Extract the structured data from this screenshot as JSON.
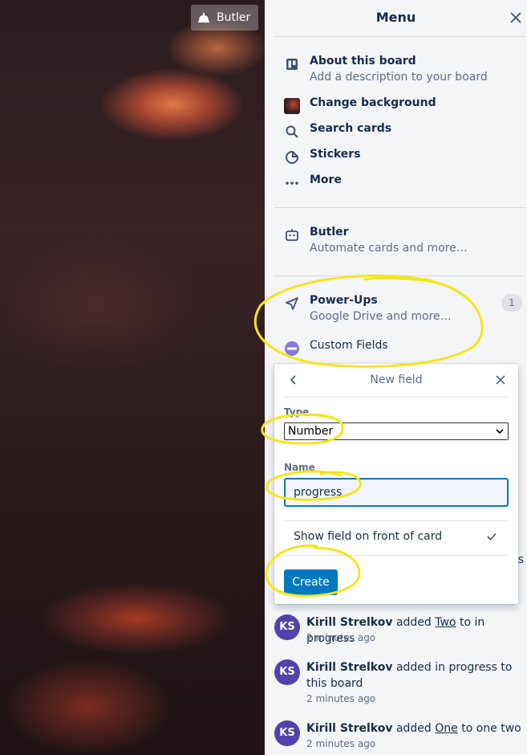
{
  "board": {
    "butler_button_label": "Butler"
  },
  "menu": {
    "title": "Menu",
    "items": [
      {
        "label": "About this board",
        "sub": "Add a description to your board",
        "icon": "board-icon"
      },
      {
        "label": "Change background",
        "icon": "background-thumbnail"
      },
      {
        "label": "Search cards",
        "icon": "search-icon"
      },
      {
        "label": "Stickers",
        "icon": "sticker-icon"
      },
      {
        "label": "More",
        "icon": "ellipsis-icon"
      }
    ],
    "butler": {
      "label": "Butler",
      "sub": "Automate cards and more…",
      "icon": "butler-icon"
    },
    "powerups": {
      "label": "Power-Ups",
      "sub": "Google Drive and more…",
      "badge": "1",
      "icon": "rocket-icon"
    },
    "custom_fields": {
      "label": "Custom Fields",
      "icon": "custom-fields-icon"
    }
  },
  "popover": {
    "title": "New field",
    "type_label": "Type",
    "type_value": "Number",
    "name_label": "Name",
    "name_value": "progress",
    "show_on_front_label": "Show field on front of card",
    "show_on_front_checked": true,
    "create_label": "Create"
  },
  "activity": {
    "partial_fragment": "s",
    "entries": [
      {
        "initials": "KS",
        "user": "Kirill Strelkov",
        "verb": "added",
        "object": "Two",
        "rest": "to in progress",
        "time": "2 minutes ago"
      },
      {
        "initials": "KS",
        "user": "Kirill Strelkov",
        "verb": "added",
        "object": "",
        "rest": "in progress to this board",
        "time": "2 minutes ago"
      },
      {
        "initials": "KS",
        "user": "Kirill Strelkov",
        "verb": "added",
        "object": "One",
        "rest": "to one two",
        "time": "2 minutes ago"
      }
    ]
  },
  "colors": {
    "accent": "#0079bf",
    "avatar": "#5243aa",
    "annotation": "#f5e51b"
  }
}
